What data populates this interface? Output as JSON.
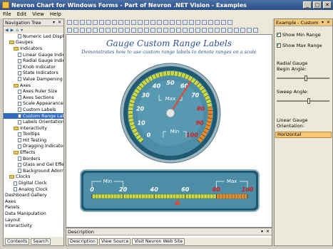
{
  "window": {
    "title": "Nevron Chart for Windows Forms - Part of Nevron .NET Vision - Examples"
  },
  "menu": [
    "File",
    "Edit",
    "View",
    "Help"
  ],
  "nav": {
    "title": "Navigation Tree",
    "items": [
      {
        "label": "Numeric Led Display",
        "indent": 3,
        "kind": "doc"
      },
      {
        "label": "Gauges",
        "indent": 1,
        "kind": "folder"
      },
      {
        "label": "Indicators",
        "indent": 2,
        "kind": "folder"
      },
      {
        "label": "Linear Gauge Indicators",
        "indent": 3,
        "kind": "doc"
      },
      {
        "label": "Radial Gauge Indicators",
        "indent": 3,
        "kind": "doc"
      },
      {
        "label": "Knob Indicator",
        "indent": 3,
        "kind": "doc"
      },
      {
        "label": "State Indicators",
        "indent": 3,
        "kind": "doc"
      },
      {
        "label": "Value Dampening",
        "indent": 3,
        "kind": "doc"
      },
      {
        "label": "Axes",
        "indent": 2,
        "kind": "folder"
      },
      {
        "label": "Axes Ruler Size",
        "indent": 3,
        "kind": "doc"
      },
      {
        "label": "Axes Sections",
        "indent": 3,
        "kind": "doc"
      },
      {
        "label": "Scale Appearance",
        "indent": 3,
        "kind": "doc"
      },
      {
        "label": "Custom Labels",
        "indent": 3,
        "kind": "doc"
      },
      {
        "label": "Custom Range Labels",
        "indent": 3,
        "kind": "doc",
        "selected": true
      },
      {
        "label": "Labels Orientation",
        "indent": 3,
        "kind": "doc"
      },
      {
        "label": "Interactivity",
        "indent": 2,
        "kind": "folder"
      },
      {
        "label": "Tooltips",
        "indent": 3,
        "kind": "doc"
      },
      {
        "label": "Hit Testing",
        "indent": 3,
        "kind": "doc"
      },
      {
        "label": "Dragging Indicators",
        "indent": 3,
        "kind": "doc"
      },
      {
        "label": "Effects",
        "indent": 2,
        "kind": "folder"
      },
      {
        "label": "Borders",
        "indent": 3,
        "kind": "doc"
      },
      {
        "label": "Glass and Gel Effects",
        "indent": 3,
        "kind": "doc"
      },
      {
        "label": "Background Adornments",
        "indent": 3,
        "kind": "doc"
      },
      {
        "label": "Clocks",
        "indent": 1,
        "kind": "folder"
      },
      {
        "label": "Digital Clock",
        "indent": 2,
        "kind": "doc"
      },
      {
        "label": "Analog Clock",
        "indent": 2,
        "kind": "doc"
      },
      {
        "label": "Dashboard Gallery",
        "indent": 0,
        "kind": "none"
      },
      {
        "label": "Axes",
        "indent": 0,
        "kind": "none"
      },
      {
        "label": "Panels",
        "indent": 0,
        "kind": "none"
      },
      {
        "label": "Data Manipulation",
        "indent": 0,
        "kind": "none"
      },
      {
        "label": "Layout",
        "indent": 0,
        "kind": "none"
      },
      {
        "label": "Interactivity",
        "indent": 0,
        "kind": "none"
      }
    ],
    "tab_contents": "Contents",
    "tab_search": "Search"
  },
  "chart": {
    "title": "Gauge Custom Range Labels",
    "subtitle": "Demonstrates how to use custom range labels to denote ranges on a scale",
    "radial": {
      "ticks": [
        "0",
        "10",
        "20",
        "30",
        "40",
        "50",
        "60",
        "70",
        "80",
        "90",
        "100"
      ],
      "red_ticks": [
        "80",
        "90",
        "100"
      ],
      "min_label": "Min",
      "max_label": "Max",
      "value": 62
    },
    "linear": {
      "ticks": [
        "0",
        "20",
        "40",
        "60",
        "80",
        "100"
      ],
      "red_ticks": [
        "80",
        "100"
      ],
      "min_label": "Min",
      "max_label": "Max",
      "value": 55
    },
    "colors": {
      "accent": "#3c7f97",
      "bezel": "#1f5a72",
      "danger": "#d42020"
    }
  },
  "description": {
    "title": "Description",
    "tab_description": "Description",
    "tab_view_source": "View Source",
    "tab_visit": "Visit Nevron Web Site"
  },
  "panel": {
    "title": "Example - Custom Range Labels",
    "show_min_range": "Show Min Range",
    "show_max_range": "Show Max Range",
    "radial_gauge_section": "Radial Gauge",
    "begin_angle_label": "Begin Angle:",
    "sweep_angle_label": "Sweep Angle:",
    "linear_gauge_orientation_label": "Linear Gauge Orientation:",
    "orientation_value": "Horizontal",
    "begin_angle_level": 0.55,
    "sweep_angle_level": 0.62
  }
}
